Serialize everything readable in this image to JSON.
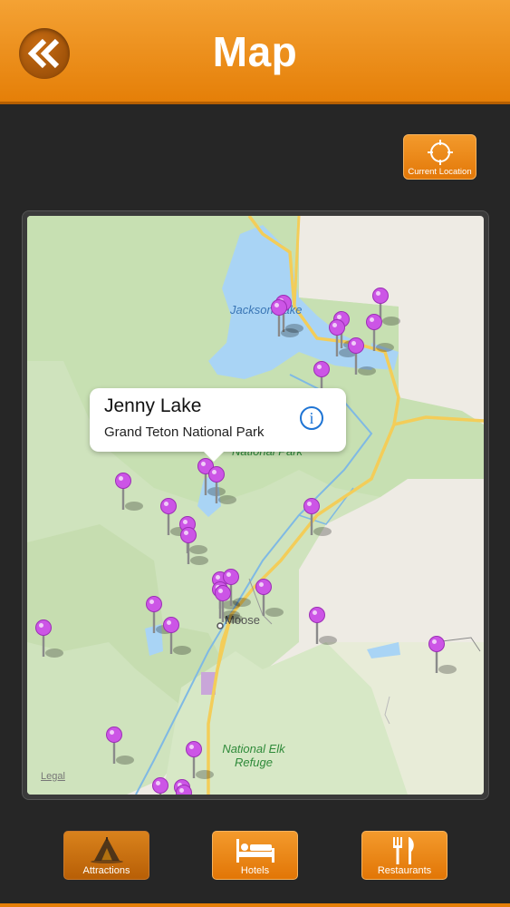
{
  "header": {
    "title": "Map"
  },
  "current_location": {
    "label": "Current Location"
  },
  "map": {
    "labels": {
      "jackson_lake": "Jackson Lake",
      "national_park": "National Park",
      "moose": "Moose",
      "elk_refuge": "National Elk Refuge",
      "legal": "Legal"
    },
    "callout": {
      "title": "Jenny Lake",
      "subtitle": "Grand Teton National Park"
    },
    "pin_color": "#cc55e6"
  },
  "tabs": [
    {
      "label": "Attractions",
      "icon": "tent-icon"
    },
    {
      "label": "Hotels",
      "icon": "bed-icon"
    },
    {
      "label": "Restaurants",
      "icon": "fork-knife-icon"
    }
  ],
  "colors": {
    "accent": "#e57f08",
    "background": "#262626"
  }
}
